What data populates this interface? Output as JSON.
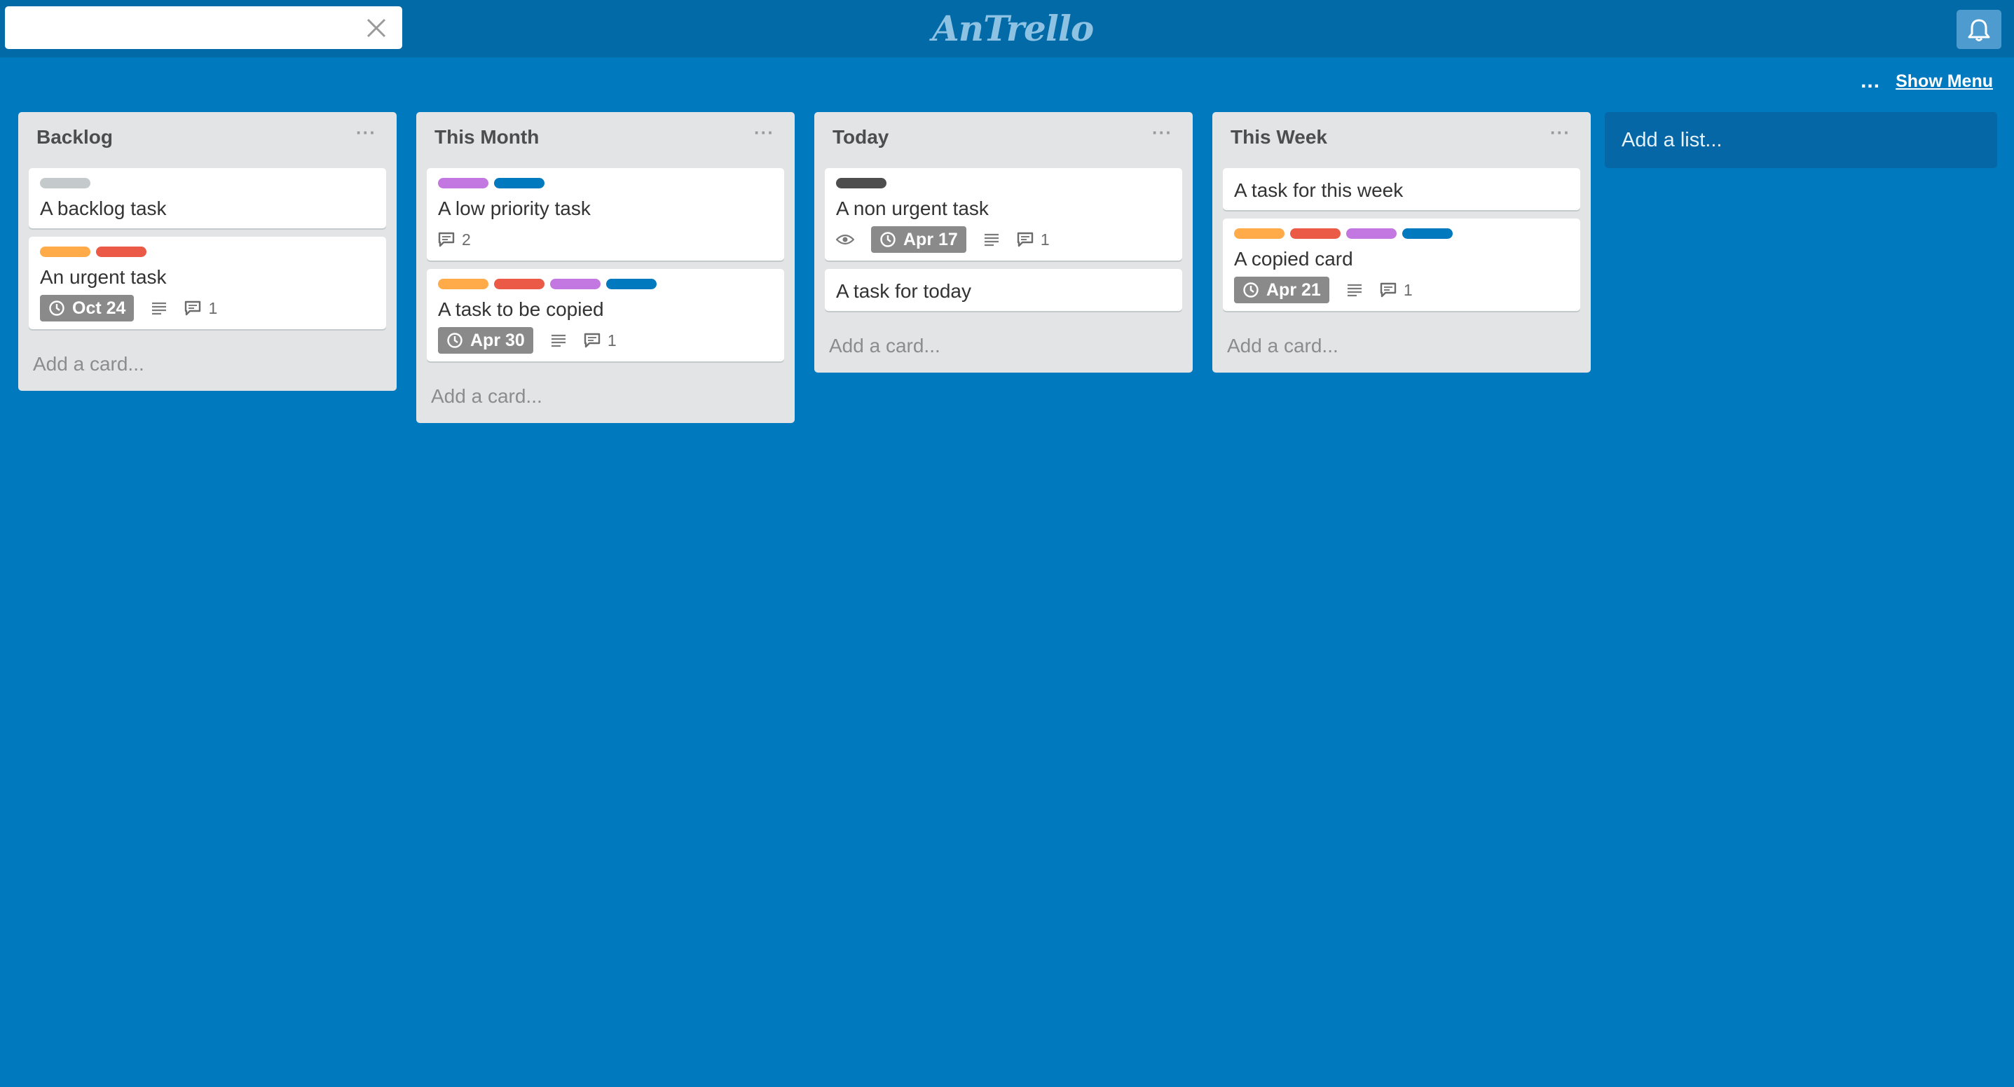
{
  "header": {
    "search_value": "",
    "logo": "AnTrello"
  },
  "board_menu": {
    "dots": "...",
    "show_menu": "Show Menu"
  },
  "colors": {
    "background": "#0079bf",
    "label_grey": "#c4c9cc",
    "label_orange": "#ffab4a",
    "label_red": "#eb5a46",
    "label_purple": "#c377e0",
    "label_blue": "#0079bf",
    "label_black": "#4d4d4d"
  },
  "lists": [
    {
      "title": "Backlog",
      "add_card": "Add a card...",
      "cards": [
        {
          "labels": [
            "#c4c9cc"
          ],
          "title": "A backlog task"
        },
        {
          "labels": [
            "#ffab4a",
            "#eb5a46"
          ],
          "title": "An urgent task",
          "due": "Oct 24",
          "description": true,
          "comments": "1"
        }
      ]
    },
    {
      "title": "This Month",
      "add_card": "Add a card...",
      "cards": [
        {
          "labels": [
            "#c377e0",
            "#0079bf"
          ],
          "title": "A low priority task",
          "comments": "2"
        },
        {
          "labels": [
            "#ffab4a",
            "#eb5a46",
            "#c377e0",
            "#0079bf"
          ],
          "title": "A task to be copied",
          "due": "Apr 30",
          "description": true,
          "comments": "1"
        }
      ]
    },
    {
      "title": "Today",
      "add_card": "Add a card...",
      "cards": [
        {
          "labels": [
            "#4d4d4d"
          ],
          "title": "A non urgent task",
          "watching": true,
          "due": "Apr 17",
          "description": true,
          "comments": "1"
        },
        {
          "labels": [],
          "title": "A task for today"
        }
      ]
    },
    {
      "title": "This Week",
      "add_card": "Add a card...",
      "cards": [
        {
          "labels": [],
          "title": "A task for this week"
        },
        {
          "labels": [
            "#ffab4a",
            "#eb5a46",
            "#c377e0",
            "#0079bf"
          ],
          "title": "A copied card",
          "due": "Apr 21",
          "description": true,
          "comments": "1"
        }
      ]
    }
  ],
  "add_list": "Add a list..."
}
